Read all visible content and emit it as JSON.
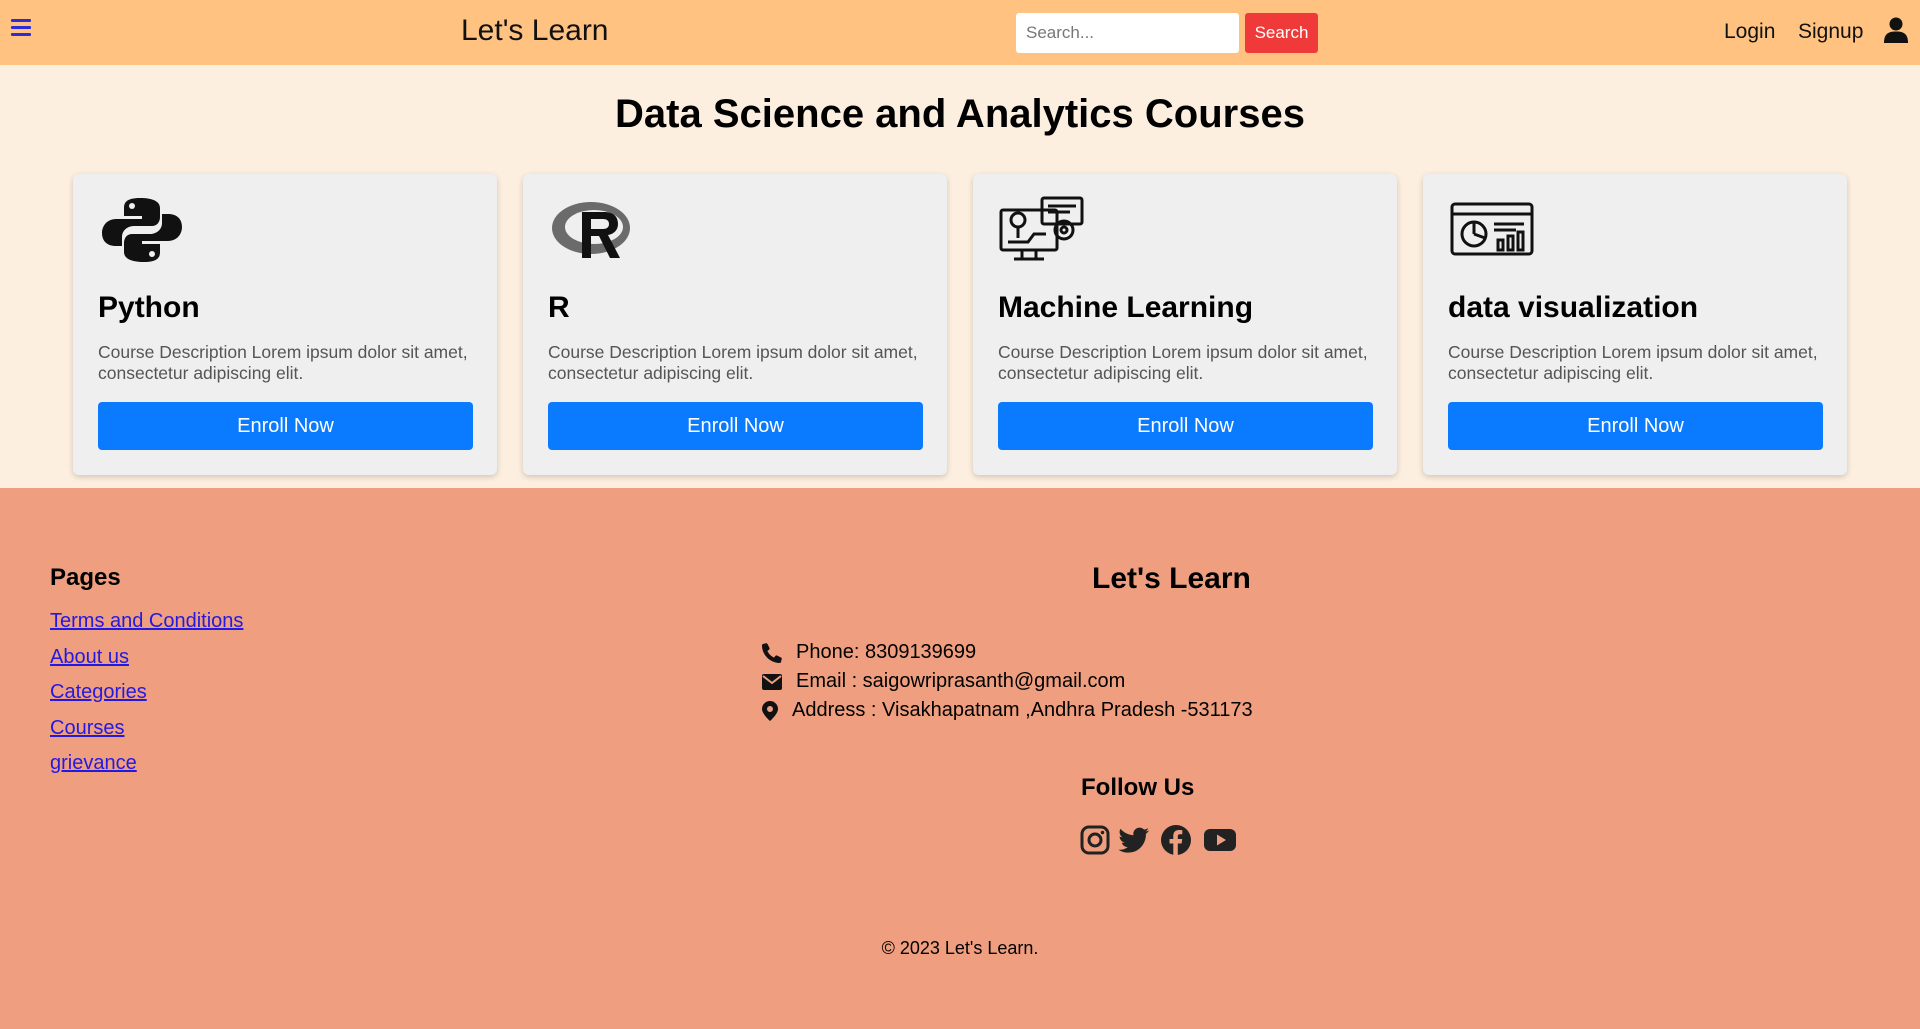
{
  "header": {
    "menu_icon": "hamburger-icon",
    "brand": "Let's Learn",
    "search": {
      "placeholder": "Search...",
      "value": "",
      "button_label": "Search"
    },
    "nav": {
      "login": "Login",
      "signup": "Signup"
    },
    "user_icon": "user-icon",
    "colors": {
      "bar": "#ffc281",
      "search_button": "#f03a3a"
    }
  },
  "main": {
    "title": "Data Science and Analytics Courses",
    "cards": [
      {
        "icon": "python-logo-icon",
        "title": "Python",
        "description": "Course Description Lorem ipsum dolor sit amet, consectetur adipiscing elit.",
        "button": "Enroll Now"
      },
      {
        "icon": "r-logo-icon",
        "title": "R",
        "description": "Course Description Lorem ipsum dolor sit amet, consectetur adipiscing elit.",
        "button": "Enroll Now"
      },
      {
        "icon": "machine-learning-icon",
        "title": "Machine Learning",
        "description": "Course Description Lorem ipsum dolor sit amet, consectetur adipiscing elit.",
        "button": "Enroll Now"
      },
      {
        "icon": "data-visualization-icon",
        "title": "data visualization",
        "description": "Course Description Lorem ipsum dolor sit amet, consectetur adipiscing elit.",
        "button": "Enroll Now"
      }
    ],
    "colors": {
      "background": "#fdefdf",
      "card": "#efefef",
      "button": "#0a7bff"
    }
  },
  "footer": {
    "pages_heading": "Pages",
    "links": [
      "Terms and Conditions",
      "About us",
      "Categories",
      "Courses",
      "grievance"
    ],
    "brand": "Let's Learn",
    "contact": {
      "phone": "Phone: 8309139699",
      "email": "Email : saigowriprasanth@gmail.com",
      "address": "Address : Visakhapatnam ,Andhra Pradesh -531173"
    },
    "follow_heading": "Follow Us",
    "social_icons": [
      "instagram-icon",
      "twitter-icon",
      "facebook-icon",
      "youtube-icon"
    ],
    "copyright": "© 2023 Let's Learn.",
    "colors": {
      "background": "#ef9f7f",
      "link": "#2419e0"
    }
  }
}
